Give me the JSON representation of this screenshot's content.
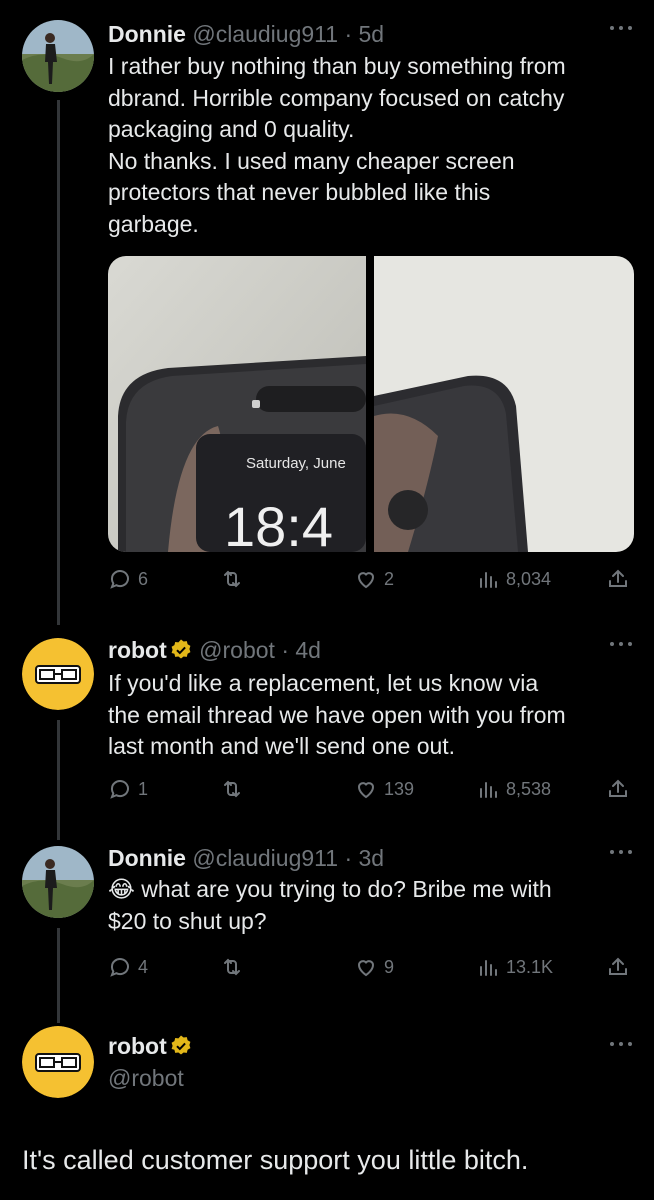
{
  "colors": {
    "background": "#000000",
    "text": "#e7e9ea",
    "muted": "#71767b",
    "verified": "#e2b719",
    "robot_avatar": "#f5c131"
  },
  "tweets": [
    {
      "name": "Donnie",
      "handle": "@claudiug911",
      "time": "· 5d",
      "avatar": "photo-avatar",
      "lines": [
        "I rather buy nothing than buy something from",
        "dbrand. Horrible company focused on catchy",
        "packaging and 0 quality.",
        "No thanks. I used many cheaper screen",
        "protectors that never bubbled like this",
        "garbage."
      ],
      "media": {
        "date_text": "Saturday, June",
        "time_text": "18:4"
      },
      "replies": "6",
      "likes": "2",
      "views": "8,034"
    },
    {
      "name": "robot",
      "handle": "@robot",
      "time": "· 4d",
      "avatar": "robot-logo-avatar",
      "verified": true,
      "lines": [
        "If you'd like a replacement, let us know via",
        "the email thread we have open with you from",
        "last month and we'll send one out."
      ],
      "replies": "1",
      "likes": "139",
      "views": "8,538"
    },
    {
      "name": "Donnie",
      "handle": "@claudiug911",
      "time": "· 3d",
      "avatar": "photo-avatar",
      "emoji": "😂",
      "lines": [
        " what are you trying to do? Bribe me with",
        "$20 to shut up?"
      ],
      "replies": "4",
      "likes": "9",
      "views": "13.1K"
    },
    {
      "name": "robot",
      "handle": "@robot",
      "avatar": "robot-logo-avatar",
      "verified": true,
      "body": "It's called customer support you little bitch."
    }
  ]
}
